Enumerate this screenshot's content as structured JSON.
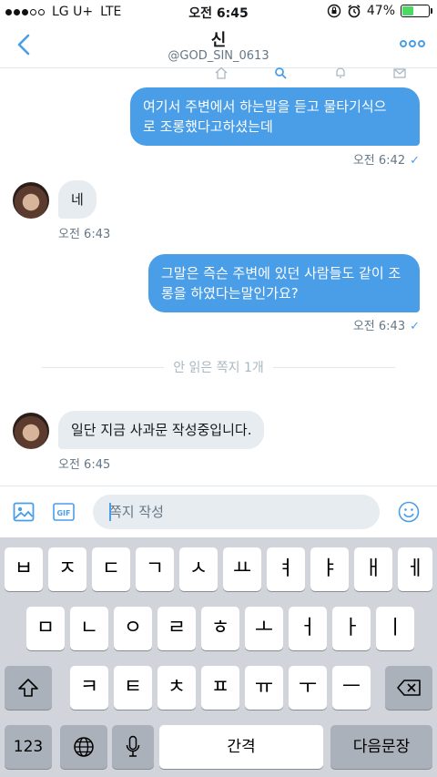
{
  "status_bar": {
    "carrier": "LG U+",
    "network": "LTE",
    "time": "오전 6:45",
    "battery": "47%",
    "battery_level": 0.47
  },
  "header": {
    "title": "신",
    "handle": "@GOD_SIN_0613"
  },
  "messages": [
    {
      "direction": "out",
      "lines": [
        "여기서 주변에서 하는말을 듣고 물타기식으",
        "로 조롱했다고하셨는데"
      ],
      "time": "오전 6:42"
    },
    {
      "direction": "in",
      "lines": [
        "네"
      ],
      "time": "오전 6:43"
    },
    {
      "direction": "out",
      "lines": [
        "그말은 즉슨 주변에 있던 사람들도 같이 조",
        "롱을 하였다는말인가요?"
      ],
      "time": "오전 6:43"
    },
    {
      "direction": "in",
      "lines": [
        "일단 지금 사과문 작성중입니다."
      ],
      "time": "오전 6:45"
    }
  ],
  "unread_divider": "안 읽은 쪽지 1개",
  "composer": {
    "placeholder": "쪽지 작성",
    "gif_label": "GIF"
  },
  "keyboard": {
    "row1": [
      "ㅂ",
      "ㅈ",
      "ㄷ",
      "ㄱ",
      "ㅅ",
      "ㅛ",
      "ㅕ",
      "ㅑ",
      "ㅐ",
      "ㅔ"
    ],
    "row2": [
      "ㅁ",
      "ㄴ",
      "ㅇ",
      "ㄹ",
      "ㅎ",
      "ㅗ",
      "ㅓ",
      "ㅏ",
      "ㅣ"
    ],
    "row3": [
      "ㅋ",
      "ㅌ",
      "ㅊ",
      "ㅍ",
      "ㅠ",
      "ㅜ",
      "ㅡ"
    ],
    "numbers_key": "123",
    "space_key": "간격",
    "return_key": "다음문장"
  },
  "colors": {
    "accent": "#4a9ee8",
    "incoming_bubble": "#e6ecf0",
    "battery": "#4cd964"
  }
}
